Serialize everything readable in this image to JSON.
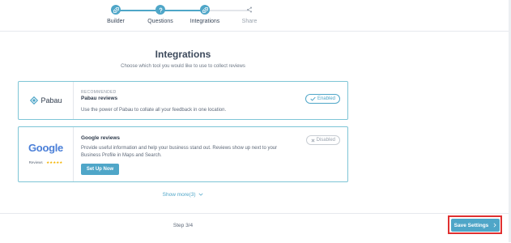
{
  "stepper": {
    "steps": [
      {
        "label": "Builder",
        "state": "done"
      },
      {
        "label": "Questions",
        "state": "done"
      },
      {
        "label": "Integrations",
        "state": "current"
      },
      {
        "label": "Share",
        "state": "pending"
      }
    ]
  },
  "main": {
    "title": "Integrations",
    "subtitle": "Choose which tool you would like to use to collect reviews"
  },
  "cards": [
    {
      "logo_text": "Pabau",
      "tag": "RECOMMENDED",
      "title": "Pabau reviews",
      "description": "Use the power of Pabau to collate all your feedback in one location.",
      "status": "Enabled"
    },
    {
      "logo_text": "Google",
      "logo_subtext": "Reviews",
      "title": "Google reviews",
      "description": "Provide useful information and help your business stand out. Reviews show up next to your Business Profile in Maps and Search.",
      "status": "Disabled",
      "button_label": "Set Up Now"
    }
  ],
  "show_more": "Show more(3)",
  "footer": {
    "step_text": "Step 3/4",
    "save_label": "Save Settings"
  },
  "colors": {
    "accent": "#4fa6c8",
    "highlight": "#e03030"
  }
}
